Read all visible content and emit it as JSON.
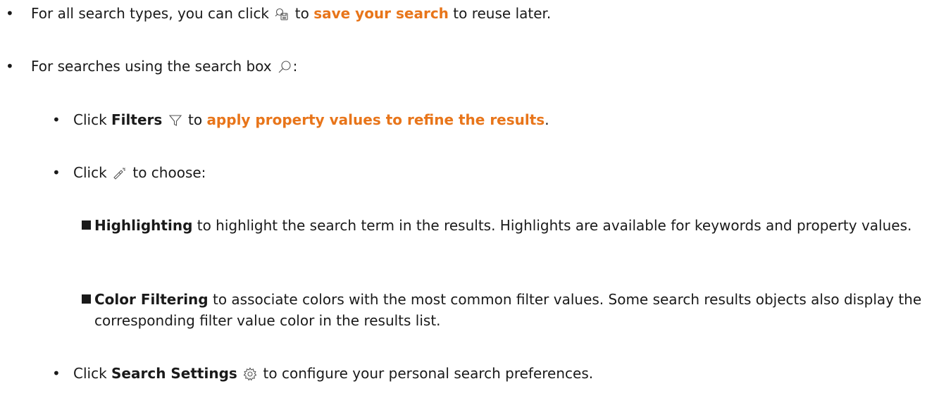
{
  "item1": {
    "text_before": "For all search types, you can click",
    "text_to": "to",
    "link": "save your search",
    "text_after": "to reuse later.",
    "icon": "save-search-icon"
  },
  "item2": {
    "text_before": "For searches using the search box",
    "text_after": ":",
    "icon": "search-icon"
  },
  "sub1": {
    "text_click": "Click",
    "bold": "Filters",
    "text_to": "to",
    "link": "apply property values to refine the results",
    "text_after": ".",
    "icon": "filter-icon"
  },
  "sub2": {
    "text_click": "Click",
    "text_after": "to choose:",
    "icon": "flashlight-icon"
  },
  "opt1": {
    "bold": "Highlighting",
    "text": "to highlight the search term in the results. Highlights are available for keywords and property values."
  },
  "opt2": {
    "bold": "Color Filtering",
    "text": "to associate colors with the most common filter values. Some search results objects also display the corresponding filter value color in the results list."
  },
  "sub3": {
    "text_click": "Click",
    "bold": "Search Settings",
    "text_after": "to configure your personal search preferences.",
    "icon": "gear-icon"
  },
  "colors": {
    "link": "#e8751a",
    "text": "#1a1a1a"
  }
}
